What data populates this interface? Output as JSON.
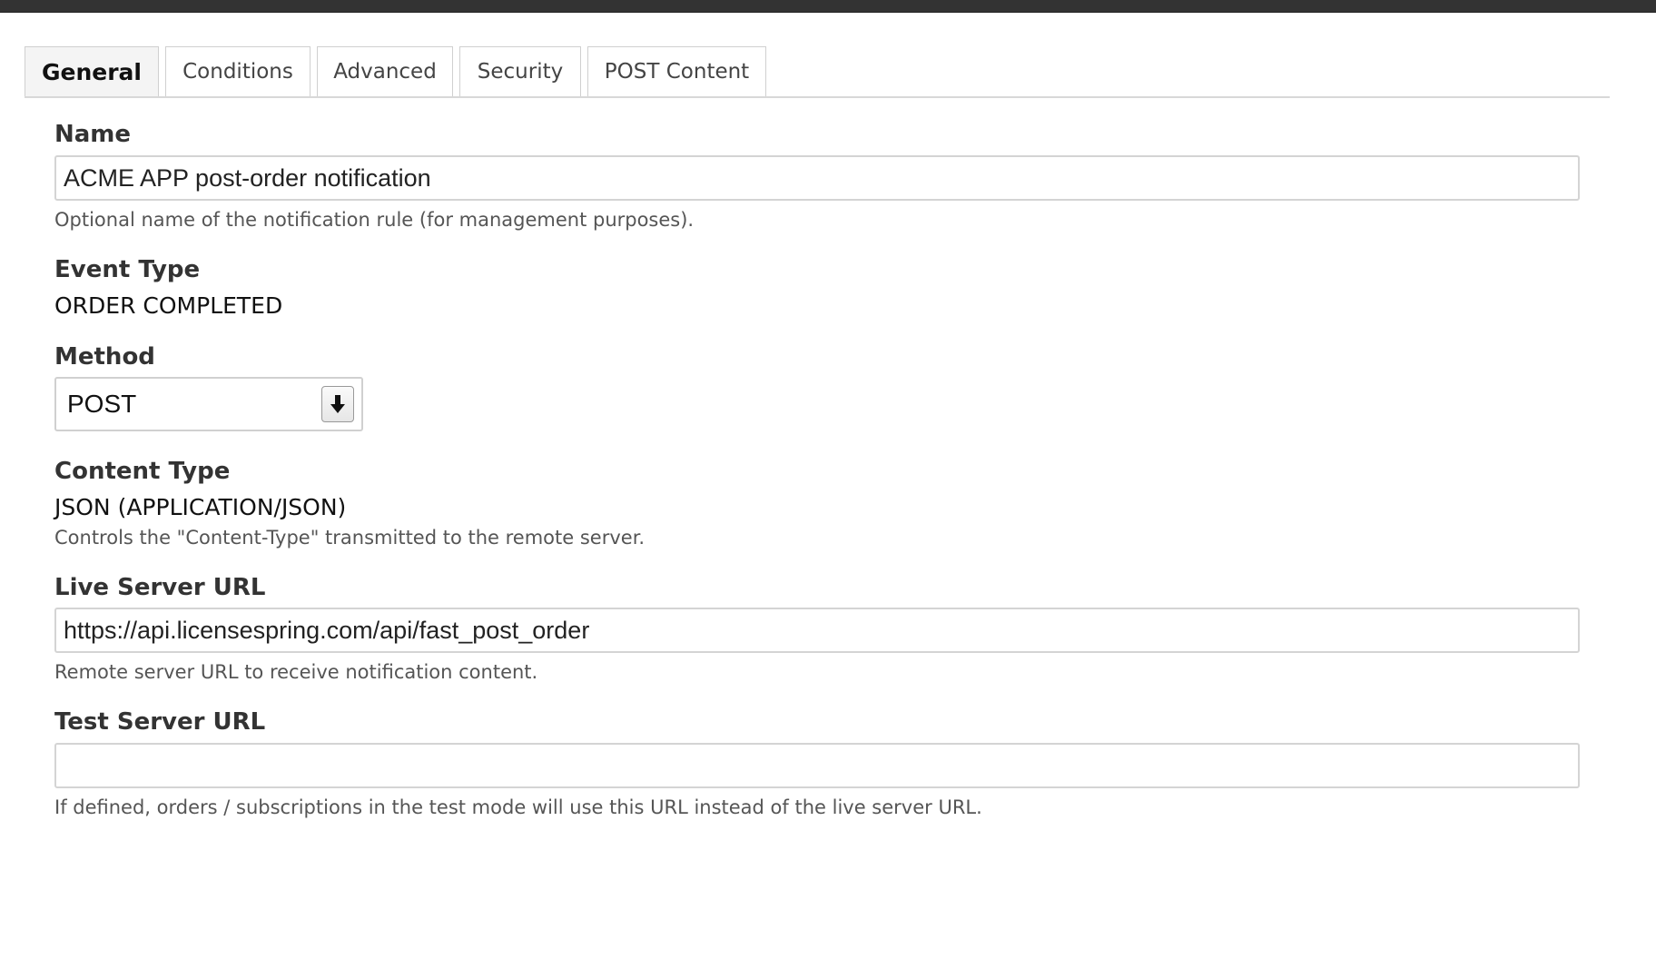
{
  "tabs": [
    {
      "label": "General",
      "active": true
    },
    {
      "label": "Conditions",
      "active": false
    },
    {
      "label": "Advanced",
      "active": false
    },
    {
      "label": "Security",
      "active": false
    },
    {
      "label": "POST Content",
      "active": false
    }
  ],
  "form": {
    "name": {
      "label": "Name",
      "value": "ACME APP post-order notification",
      "help": "Optional name of the notification rule (for management purposes)."
    },
    "event_type": {
      "label": "Event Type",
      "value": "ORDER COMPLETED"
    },
    "method": {
      "label": "Method",
      "value": "POST",
      "arrow_icon": "arrow-down-icon"
    },
    "content_type": {
      "label": "Content Type",
      "value": "JSON (APPLICATION/JSON)",
      "help": "Controls the \"Content-Type\" transmitted to the remote server."
    },
    "live_url": {
      "label": "Live Server URL",
      "value": "https://api.licensespring.com/api/fast_post_order",
      "help": "Remote server URL to receive notification content."
    },
    "test_url": {
      "label": "Test Server URL",
      "value": "",
      "help": "If defined, orders / subscriptions in the test mode will use this URL instead of the live server URL."
    }
  },
  "colors": {
    "top_bar": "#333333",
    "border": "#d4d4d4",
    "active_tab_bg": "#f4f4f4"
  }
}
